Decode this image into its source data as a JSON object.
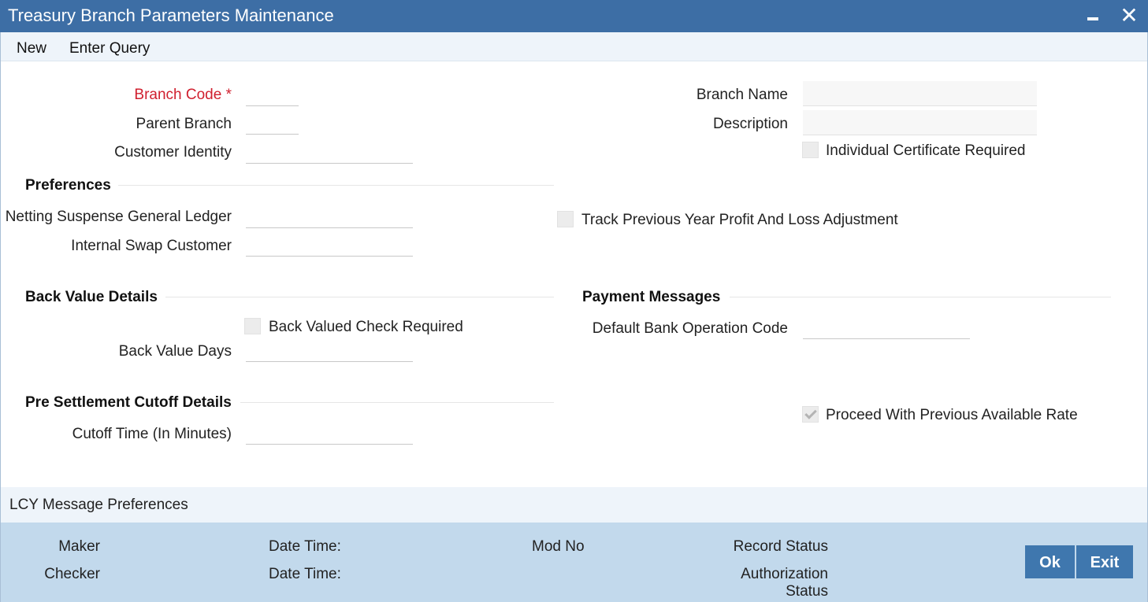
{
  "window": {
    "title": "Treasury Branch Parameters Maintenance",
    "minimize_icon": "minimize-icon",
    "close_icon": "close-icon",
    "close_glyph": "✕"
  },
  "toolbar": {
    "new_label": "New",
    "enter_query_label": "Enter Query"
  },
  "form": {
    "branch_code": {
      "label": "Branch Code",
      "required_mark": "*",
      "value": ""
    },
    "parent_branch": {
      "label": "Parent Branch",
      "value": ""
    },
    "customer_identity": {
      "label": "Customer Identity",
      "value": ""
    },
    "branch_name": {
      "label": "Branch Name",
      "value": ""
    },
    "description": {
      "label": "Description",
      "value": ""
    },
    "individual_certificate_required": {
      "label": "Individual Certificate Required",
      "checked": false
    }
  },
  "preferences": {
    "heading": "Preferences",
    "netting_suspense_gl": {
      "label": "Netting Suspense General Ledger",
      "value": ""
    },
    "internal_swap_customer": {
      "label": "Internal Swap Customer",
      "value": ""
    },
    "track_prev_year_pl": {
      "label": "Track Previous Year Profit And Loss Adjustment",
      "checked": false
    }
  },
  "back_value": {
    "heading": "Back Value Details",
    "back_valued_check": {
      "label": "Back Valued Check Required",
      "checked": false
    },
    "back_value_days": {
      "label": "Back Value Days",
      "value": ""
    }
  },
  "payment_messages": {
    "heading": "Payment Messages",
    "default_bank_op_code": {
      "label": "Default Bank Operation Code",
      "value": ""
    }
  },
  "pre_settlement": {
    "heading": "Pre Settlement Cutoff Details",
    "cutoff_time": {
      "label": "Cutoff Time (In Minutes)",
      "value": ""
    },
    "proceed_prev_rate": {
      "label": "Proceed With Previous Available Rate",
      "checked": true
    }
  },
  "tabs": {
    "lcy_message_preferences": "LCY Message Preferences"
  },
  "footer": {
    "maker_label": "Maker",
    "checker_label": "Checker",
    "date_time_label_1": "Date Time:",
    "date_time_label_2": "Date Time:",
    "mod_no_label": "Mod No",
    "record_status_label": "Record Status",
    "authorization_status_line1": "Authorization",
    "authorization_status_line2": "Status",
    "ok_label": "Ok",
    "exit_label": "Exit"
  },
  "colors": {
    "titlebar": "#3d6ea5",
    "toolbar_bg": "#eef4fa",
    "footer_bg": "#c2d9ec",
    "button_bg": "#3f77ae",
    "required_label": "#d0202f"
  }
}
